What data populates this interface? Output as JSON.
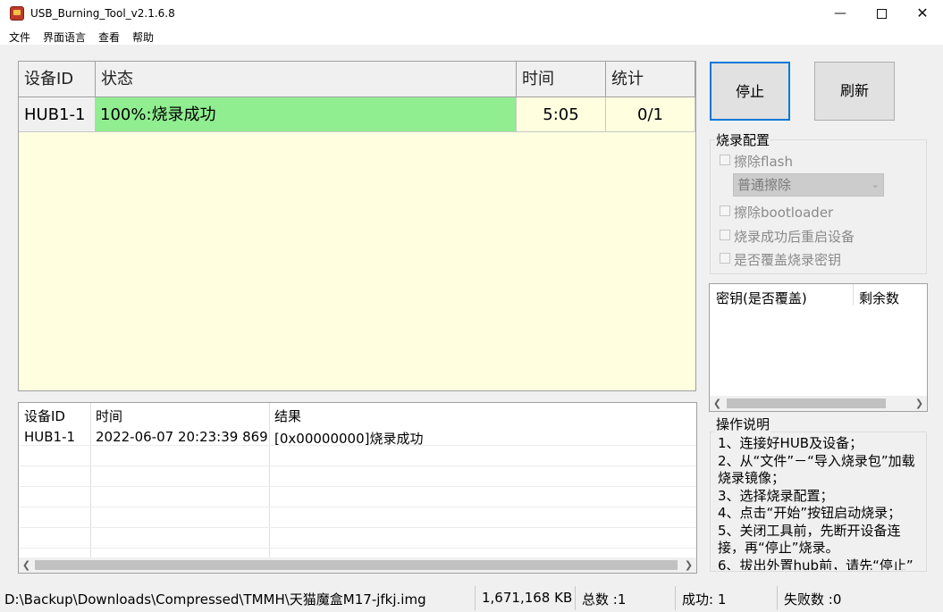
{
  "window": {
    "title": "USB_Burning_Tool_v2.1.6.8"
  },
  "menu": [
    "文件",
    "界面语言",
    "查看",
    "帮助"
  ],
  "device_grid": {
    "headers": [
      "设备ID",
      "状态",
      "时间",
      "统计"
    ],
    "rows": [
      {
        "device_id": "HUB1-1",
        "status": "100%:烧录成功",
        "time": "5:05",
        "stats": "0/1",
        "status_color": "#90ee90"
      }
    ],
    "background_color": "#ffffe0"
  },
  "buttons": {
    "stop": "停止",
    "refresh": "刷新"
  },
  "burn_config": {
    "title": "烧录配置",
    "erase_flash": "擦除flash",
    "erase_mode": "普通擦除",
    "erase_bootloader": "擦除bootloader",
    "reboot_after": "烧录成功后重启设备",
    "overwrite_key": "是否覆盖烧录密钥"
  },
  "key_table": {
    "headers": [
      "密钥(是否覆盖)",
      "剩余数"
    ]
  },
  "log_table": {
    "headers": [
      "设备ID",
      "时间",
      "结果"
    ],
    "rows": [
      {
        "device_id": "HUB1-1",
        "time": "2022-06-07 20:23:39 869",
        "result": "[0x00000000]烧录成功"
      }
    ]
  },
  "instructions": {
    "title": "操作说明",
    "text": "1、连接好HUB及设备；\n2、从“文件”－“导入烧录包”加载烧录镜像；\n3、选择烧录配置；\n4、点击“开始”按钮启动烧录；\n5、关闭工具前，先断开设备连接，再“停止”烧录。\n6、拔出外置hub前，请先“停止”"
  },
  "status_bar": {
    "path": "D:\\Backup\\Downloads\\Compressed\\TMMH\\天猫魔盒M17-jfkj.img",
    "size": "1,671,168 KB",
    "total": "总数 :1",
    "success": "成功:  1",
    "fail": "失败数 :0"
  },
  "colors": {
    "grid_bg": "#ffffe0",
    "success_green": "#90ee90",
    "stop_button_border": "#0078d7"
  }
}
